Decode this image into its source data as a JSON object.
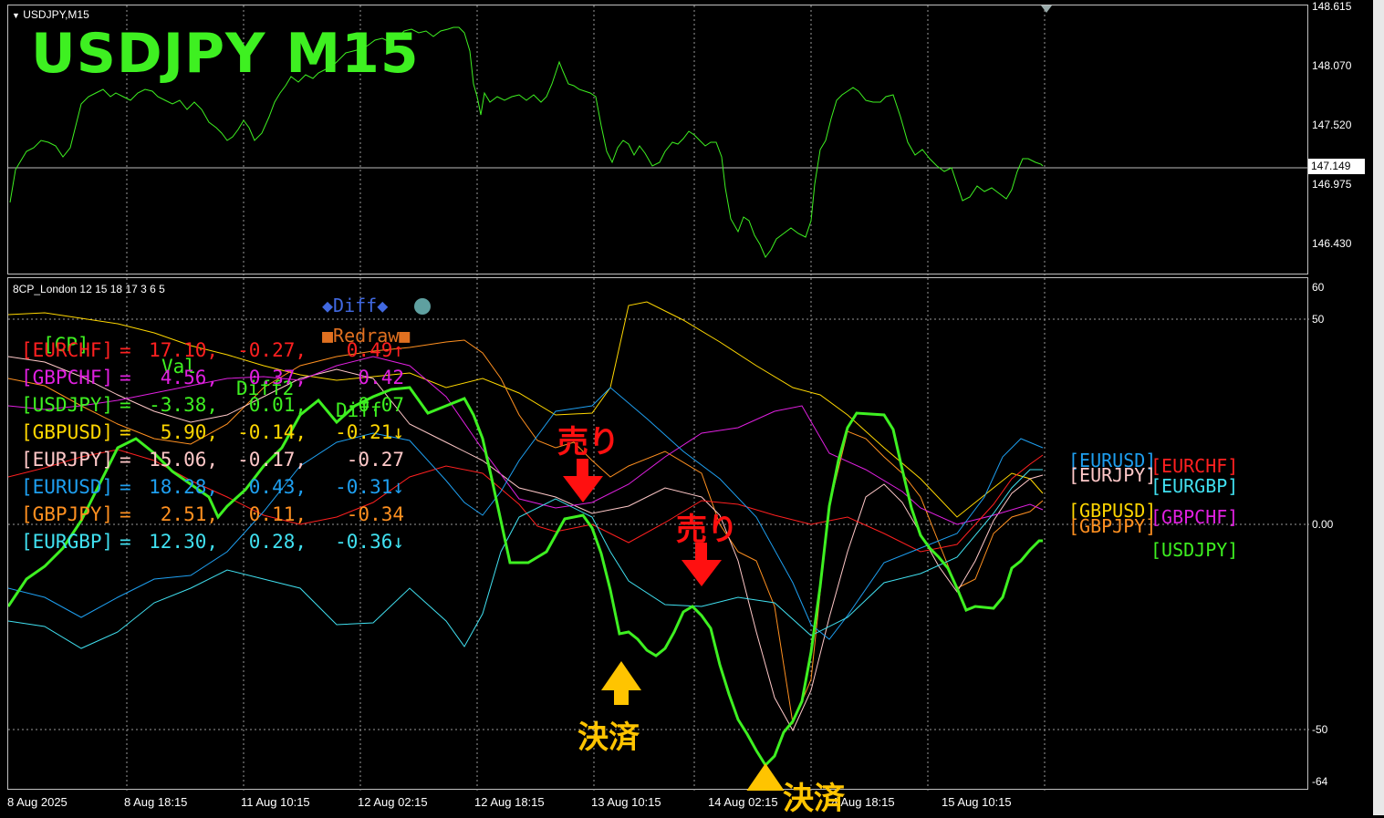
{
  "main_chart": {
    "symbol_label": "USDJPY,M15",
    "big_title": "USDJPY  M15",
    "price_scale": [
      "148.615",
      "148.070",
      "147.520",
      "146.975",
      "146.430"
    ],
    "current_price": "147.149",
    "line_color": "#3ef021"
  },
  "indicator": {
    "title": "8CP_London 12 15 18 17 3 6 5",
    "scale": [
      "60",
      "50",
      "0.00",
      "-50",
      "-64"
    ],
    "buttons": {
      "diff_label": "◆Diff◆",
      "circle_icon": "circle-icon",
      "redraw_label": "■Redraw■"
    },
    "table_header": {
      "cp": "[CP]",
      "val": "Val",
      "diff2": "Diff2",
      "diff": "Diff"
    },
    "rows": [
      {
        "pair": "[EURCHF]",
        "eq": "=",
        "val": "17.10,",
        "diff2": "-0.27,",
        "diff": "0.49",
        "arrow": "↑",
        "color": "#ff2020"
      },
      {
        "pair": "[GBPCHF]",
        "eq": "=",
        "val": "4.56,",
        "diff2": "0.37,",
        "diff": "0.42",
        "arrow": "",
        "color": "#e020e0"
      },
      {
        "pair": "[USDJPY]",
        "eq": "=",
        "val": "-3.38,",
        "diff2": "0.01,",
        "diff": "-0.07",
        "arrow": "",
        "color": "#3ef021"
      },
      {
        "pair": "[GBPUSD]",
        "eq": "=",
        "val": "5.90,",
        "diff2": "-0.14,",
        "diff": "-0.21",
        "arrow": "↓",
        "color": "#ffd700"
      },
      {
        "pair": "[EURJPY]",
        "eq": "=",
        "val": "15.06,",
        "diff2": "-0.17,",
        "diff": "-0.27",
        "arrow": "",
        "color": "#ffc8c8"
      },
      {
        "pair": "[EURUSD]",
        "eq": "=",
        "val": "18.28,",
        "diff2": "0.43,",
        "diff": "-0.31",
        "arrow": "↓",
        "color": "#1e9ff0"
      },
      {
        "pair": "[GBPJPY]",
        "eq": "=",
        "val": "2.51,",
        "diff2": "0.11,",
        "diff": "-0.34",
        "arrow": "",
        "color": "#ff9020"
      },
      {
        "pair": "[EURGBP]",
        "eq": "=",
        "val": "12.30,",
        "diff2": "0.28,",
        "diff": "-0.36",
        "arrow": "↓",
        "color": "#40e0f0"
      }
    ],
    "right_labels": {
      "eurusd": "[EURUSD]",
      "eurchf": "[EURCHF]",
      "eurjpy": "[EURJPY]",
      "eurgbp": "[EURGBP]",
      "gbpusd": "[GBPUSD]",
      "gbpjpy": "[GBPJPY]",
      "gbpchf": "[GBPCHF]",
      "usdjpy": "[USDJPY]"
    }
  },
  "annotations": {
    "sell_1": "売り",
    "sell_2": "売り",
    "settle_1": "決済",
    "settle_2": "決済",
    "sell_color": "#ff1010",
    "settle_color": "#ffc400"
  },
  "time_axis": [
    "8 Aug 2025",
    "8 Aug 18:15",
    "11 Aug 10:15",
    "12 Aug 02:15",
    "12 Aug 18:15",
    "13 Aug 10:15",
    "14 Aug 02:15",
    "14 Aug 18:15",
    "15 Aug 10:15"
  ],
  "chart_data": {
    "type": "line",
    "title": "USDJPY,M15",
    "x": [
      "8 Aug 2025",
      "8 Aug 18:15",
      "11 Aug 10:15",
      "12 Aug 02:15",
      "12 Aug 18:15",
      "13 Aug 10:15",
      "14 Aug 02:15",
      "14 Aug 18:15",
      "15 Aug 10:15"
    ],
    "series": [
      {
        "name": "USDJPY",
        "values": [
          146.9,
          147.85,
          147.7,
          148.3,
          148.15,
          147.4,
          146.5,
          147.7,
          147.15
        ]
      }
    ],
    "ylim": [
      146.2,
      148.7
    ]
  }
}
